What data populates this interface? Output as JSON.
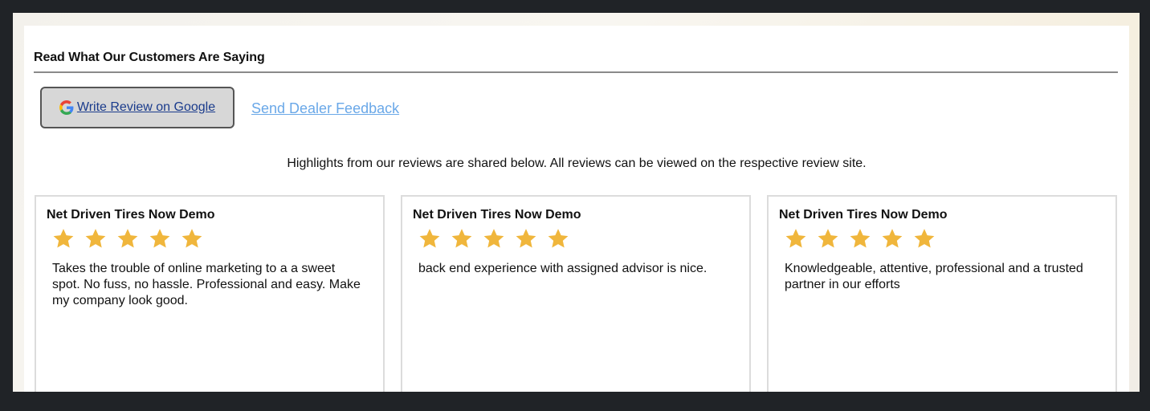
{
  "section": {
    "title": "Read What Our Customers Are Saying"
  },
  "actions": {
    "google_label": "Write Review on Google",
    "feedback_label": "Send Dealer Feedback"
  },
  "intro": "Highlights from our reviews are shared below. All reviews can be viewed on the respective review site.",
  "colors": {
    "star": "#f0b63c",
    "link": "#6aa8e8",
    "google_link": "#1a3b8c"
  },
  "reviews": [
    {
      "author": "Net Driven Tires Now Demo",
      "rating": 5,
      "text": "Takes the trouble of online marketing to a a sweet spot. No fuss, no hassle. Professional and easy. Make my company look good."
    },
    {
      "author": "Net Driven Tires Now Demo",
      "rating": 5,
      "text": "back end experience with assigned advisor is nice."
    },
    {
      "author": "Net Driven Tires Now Demo",
      "rating": 5,
      "text": "Knowledgeable, attentive, professional and a trusted partner in our efforts"
    }
  ]
}
